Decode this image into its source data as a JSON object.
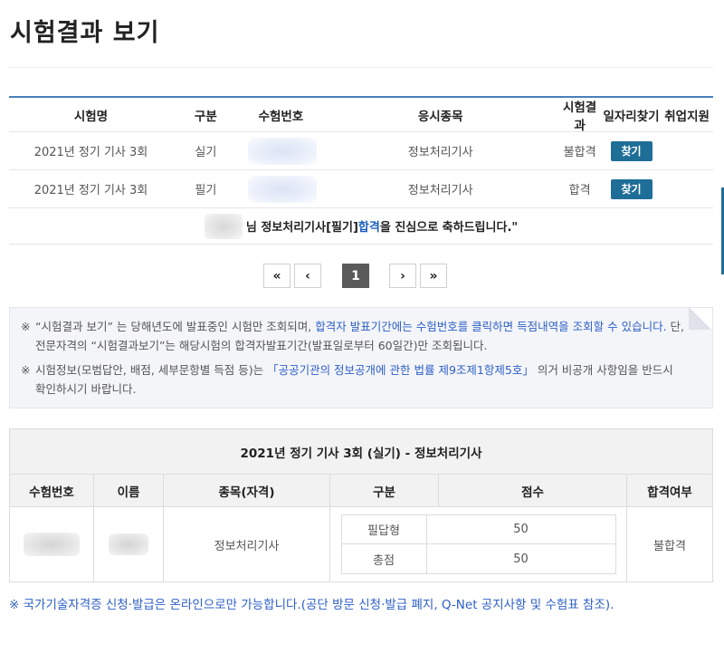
{
  "page": {
    "title": "시험결과 보기"
  },
  "results": {
    "headers": [
      "시험명",
      "구분",
      "수험번호",
      "응시종목",
      "시험결과",
      "일자리찾기",
      "취업지원"
    ],
    "rows": [
      {
        "exam": "2021년 정기 기사 3회",
        "type": "실기",
        "subject": "정보처리기사",
        "result": "불합격",
        "button": "찾기"
      },
      {
        "exam": "2021년 정기 기사 3회",
        "type": "필기",
        "subject": "정보처리기사",
        "result": "합격",
        "button": "찾기"
      }
    ],
    "congrats": {
      "prefix": "님 정보처리기사[필기] ",
      "highlight": "합격",
      "suffix": "을 진심으로 축하드립니다.\""
    }
  },
  "pagination": {
    "first": "«",
    "prev": "‹",
    "current": "1",
    "next": "›",
    "last": "»"
  },
  "notice": {
    "line1_mark": "※",
    "line1_a": "“시험결과 보기” 는 당해년도에 발표중인 시험만 조회되며, ",
    "line1_b": "합격자 발표기간에는 수험번호를 클릭하면 득점내역을 조회할 수 있습니다.",
    "line1_c": " 단, 전문자격의 “시험결과보기”는 해당시험의 합격자발표기간(발표일로부터 60일간)만 조회됩니다.",
    "line2_mark": "※",
    "line2_a": "시험정보(모범답안, 배점, 세부문항별 득점 등)는 ",
    "line2_b": "「공공기관의 정보공개에 관한 법률 제9조제1항제5호」",
    "line2_c": " 의거 비공개 사항임을 반드시 확인하시기 바랍니다."
  },
  "detail": {
    "title": "2021년 정기 기사 3회 (실기) - 정보처리기사",
    "headers": {
      "number": "수험번호",
      "name": "이름",
      "subject": "종목(자격)",
      "type": "구분",
      "score": "점수",
      "pass": "합격여부"
    },
    "subject": "정보처리기사",
    "scores": [
      {
        "label": "필답형",
        "value": "50"
      },
      {
        "label": "총점",
        "value": "50"
      }
    ],
    "pass": "불합격"
  },
  "footer_note": "※ 국가기술자격증 신청·발급은 온라인으로만 가능합니다.(공단 방문 신청·발급 폐지, Q-Net 공지사항 및 수험표 참조).",
  "colors": {
    "accent": "#1f6e98",
    "link": "#2d5fc9",
    "header_rule": "#4a7fb8"
  }
}
